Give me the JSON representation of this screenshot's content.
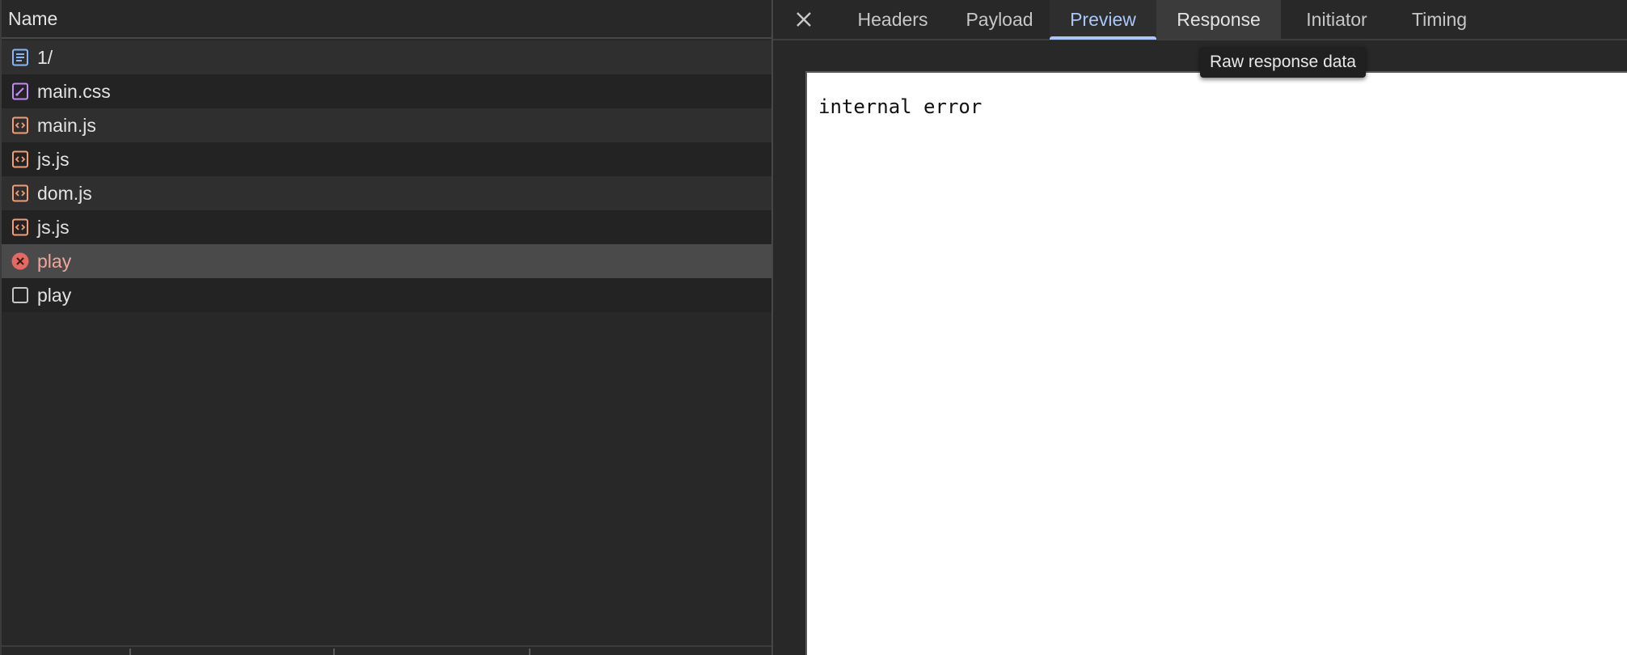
{
  "list": {
    "column_header": "Name",
    "requests": [
      {
        "name": "1/",
        "icon": "document-icon",
        "icon_color": "#8ab4f8",
        "status": "ok"
      },
      {
        "name": "main.css",
        "icon": "stylesheet-icon",
        "icon_color": "#c58af9",
        "status": "ok"
      },
      {
        "name": "main.js",
        "icon": "script-icon",
        "icon_color": "#f29d76",
        "status": "ok"
      },
      {
        "name": "js.js",
        "icon": "script-icon",
        "icon_color": "#f29d76",
        "status": "ok"
      },
      {
        "name": "dom.js",
        "icon": "script-icon",
        "icon_color": "#f29d76",
        "status": "ok"
      },
      {
        "name": "js.js",
        "icon": "script-icon",
        "icon_color": "#f29d76",
        "status": "ok"
      },
      {
        "name": "play",
        "icon": "error-circle-icon",
        "icon_color": "#e46962",
        "status": "error",
        "selected": true
      },
      {
        "name": "play",
        "icon": "blank-file-icon",
        "icon_color": "#c7c7c7",
        "status": "ok"
      }
    ]
  },
  "details": {
    "close_icon": "close-icon",
    "tabs": [
      {
        "label": "Headers",
        "state": "normal"
      },
      {
        "label": "Payload",
        "state": "normal"
      },
      {
        "label": "Preview",
        "state": "active"
      },
      {
        "label": "Response",
        "state": "hovered"
      },
      {
        "label": "Initiator",
        "state": "normal"
      },
      {
        "label": "Timing",
        "state": "normal"
      }
    ],
    "tooltip": "Raw response data",
    "preview_body": "internal error"
  },
  "colors": {
    "accent": "#a8c7fa",
    "error_text": "#f2a59e",
    "panel_bg": "#282828"
  }
}
